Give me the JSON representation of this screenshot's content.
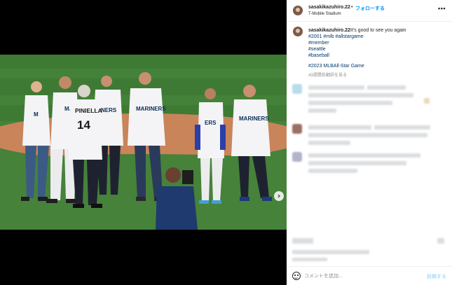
{
  "header": {
    "username": "sasakikazuhiro.22",
    "separator": "•",
    "follow_label": "フォローする",
    "location": "T-Mobile Stadium",
    "more_glyph": "•••"
  },
  "caption": {
    "username": "sasakikazuhiro.22",
    "text": "It's good to see you again",
    "hashtag_line": "#2001 #mlb #allstargame",
    "hashtags": [
      "#member",
      "#seattle",
      "#baseball"
    ],
    "event_line": "#2023 MLBAll-Star Game",
    "time_ago": "43週間前",
    "translate_label": "翻訳を見る"
  },
  "photo": {
    "players": [
      {
        "jersey_text": "M",
        "number": ""
      },
      {
        "jersey_text": "MA",
        "number": ""
      },
      {
        "jersey_text": "PINIELLA",
        "number": "14"
      },
      {
        "jersey_text": "NERS",
        "number": ""
      },
      {
        "jersey_text": "MARINERS",
        "number": ""
      },
      {
        "jersey_text": "ERS",
        "number": ""
      },
      {
        "jersey_text": "MARINERS",
        "number": ""
      }
    ],
    "slide_count": 5,
    "active_slide": 0
  },
  "comment_box": {
    "placeholder": "コメントを追加...",
    "post_label": "投稿する"
  },
  "colors": {
    "accent": "#0095f6",
    "grass": "#46823a",
    "dirt": "#d4875a",
    "jersey": "#f4f4f6"
  }
}
